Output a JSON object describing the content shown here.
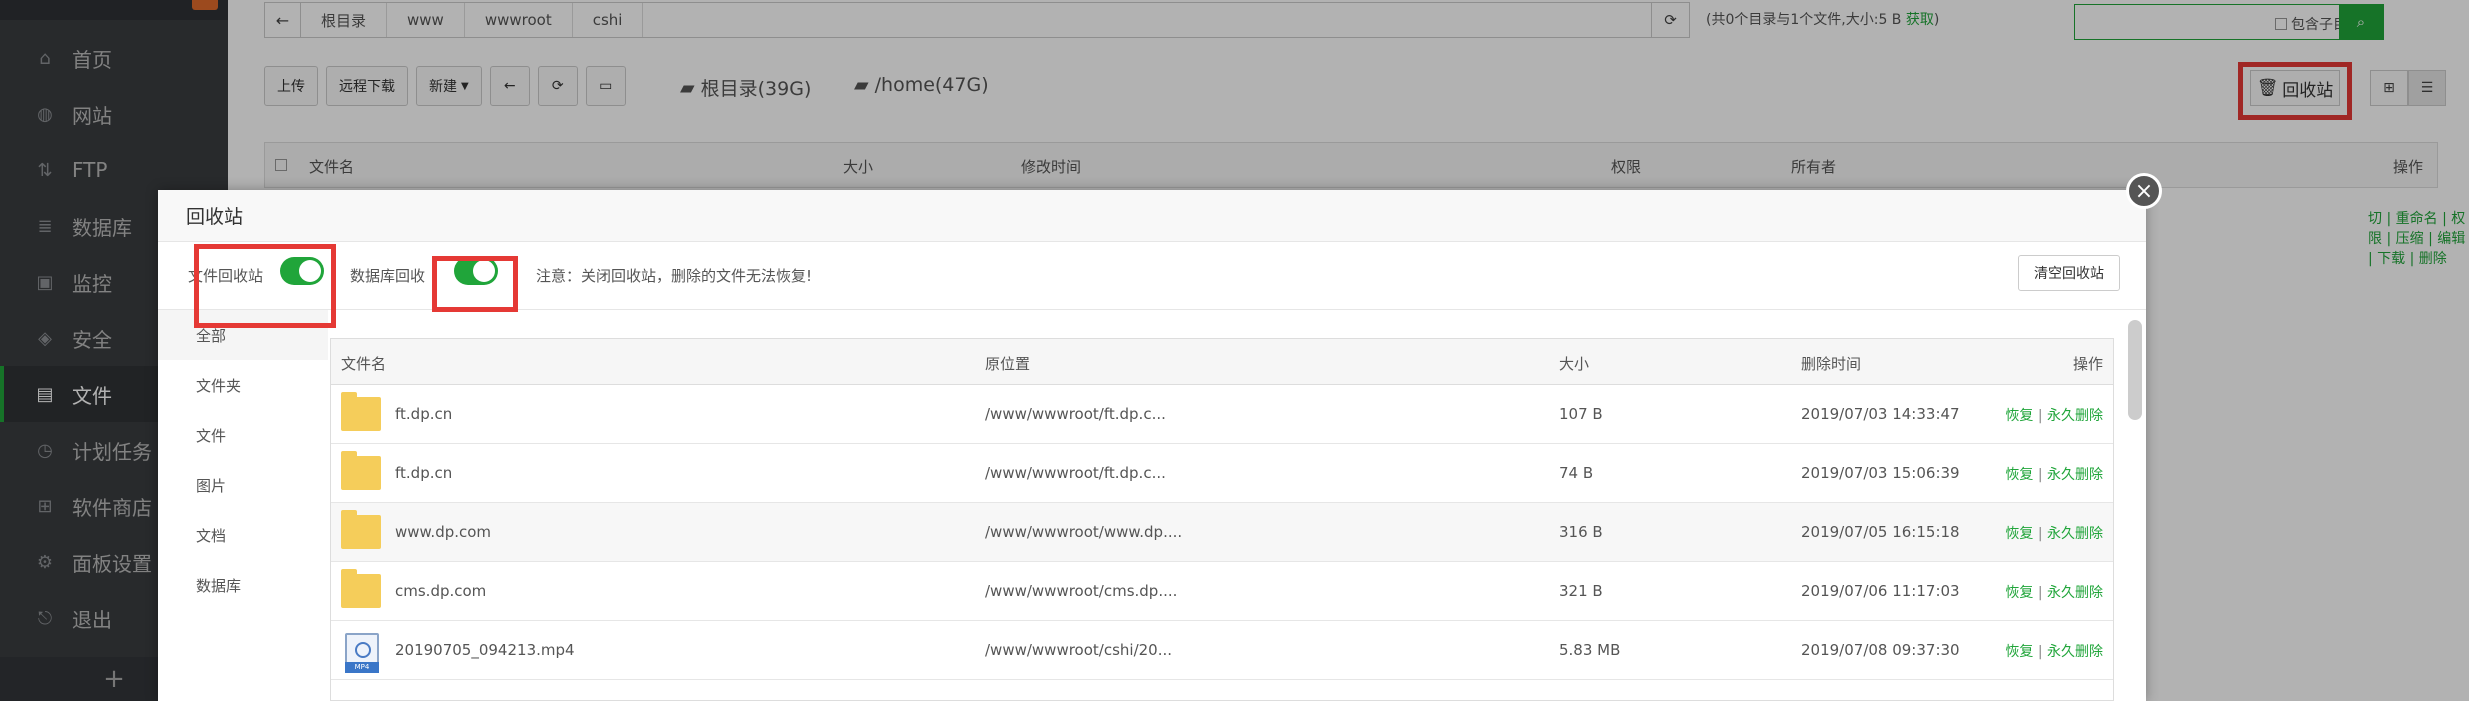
{
  "sidebar": {
    "items": [
      {
        "label": "首页",
        "icon": "home-icon"
      },
      {
        "label": "网站",
        "icon": "globe-icon"
      },
      {
        "label": "FTP",
        "icon": "ftp-icon"
      },
      {
        "label": "数据库",
        "icon": "database-icon"
      },
      {
        "label": "监控",
        "icon": "monitor-icon"
      },
      {
        "label": "安全",
        "icon": "shield-icon"
      },
      {
        "label": "文件",
        "icon": "folder-icon"
      },
      {
        "label": "计划任务",
        "icon": "clock-icon"
      },
      {
        "label": "软件商店",
        "icon": "apps-icon"
      },
      {
        "label": "面板设置",
        "icon": "gear-icon"
      },
      {
        "label": "退出",
        "icon": "logout-icon"
      }
    ],
    "active_index": 6,
    "plus": "+"
  },
  "path": {
    "crumbs": [
      "根目录",
      "www",
      "wwwroot",
      "cshi"
    ],
    "info": "(共0个目录与1个文件,大小:5 B ",
    "get": "获取",
    "info_end": ")"
  },
  "search": {
    "include_sub": "包含子目录"
  },
  "toolbar": {
    "upload": "上传",
    "remote": "远程下载",
    "new": "新建",
    "disk_root": "根目录(39G)",
    "disk_home": "/home(47G)",
    "recycle": "回收站"
  },
  "file_header": {
    "name": "文件名",
    "size": "大小",
    "mtime": "修改时间",
    "perm": "权限",
    "owner": "所有者",
    "ops": "操作"
  },
  "background_row_actions": "切 | 重命名 | 权限 | 压缩 | 编辑 | 下载 | 删除",
  "modal": {
    "title": "回收站",
    "file_recycle_label": "文件回收站",
    "db_recycle_label": "数据库回收",
    "note": "注意：关闭回收站，删除的文件无法恢复!",
    "clear_button": "清空回收站",
    "close": "×",
    "categories": [
      "全部",
      "文件夹",
      "文件",
      "图片",
      "文档",
      "数据库"
    ],
    "columns": {
      "name": "文件名",
      "origin": "原位置",
      "size": "大小",
      "deleted": "删除时间",
      "ops": "操作"
    },
    "restore": "恢复",
    "delete_forever": "永久删除",
    "rows": [
      {
        "type": "folder",
        "name": "ft.dp.cn",
        "origin": "/www/wwwroot/ft.dp.c...",
        "size": "107 B",
        "deleted": "2019/07/03 14:33:47"
      },
      {
        "type": "folder",
        "name": "ft.dp.cn",
        "origin": "/www/wwwroot/ft.dp.c...",
        "size": "74 B",
        "deleted": "2019/07/03 15:06:39"
      },
      {
        "type": "folder",
        "name": "www.dp.com",
        "origin": "/www/wwwroot/www.dp....",
        "size": "316 B",
        "deleted": "2019/07/05 16:15:18"
      },
      {
        "type": "folder",
        "name": "cms.dp.com",
        "origin": "/www/wwwroot/cms.dp....",
        "size": "321 B",
        "deleted": "2019/07/06 11:17:03"
      },
      {
        "type": "mp4",
        "name": "20190705_094213.mp4",
        "origin": "/www/wwwroot/cshi/20...",
        "size": "5.83 MB",
        "deleted": "2019/07/08 09:37:30"
      }
    ]
  },
  "colors": {
    "accent": "#20a53a",
    "highlight": "#e53935",
    "sidebar_bg": "#3a3d40"
  }
}
